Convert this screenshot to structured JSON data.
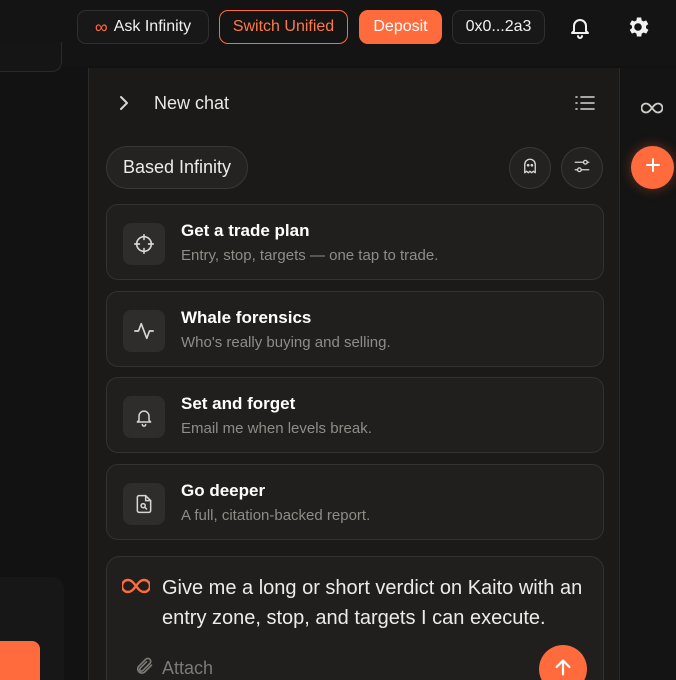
{
  "header": {
    "ask_label": "Ask Infinity",
    "ask_symbol": "∞",
    "switch_label": "Switch Unified",
    "deposit_label": "Deposit",
    "wallet_address": "0x0...2a3",
    "icons": [
      "bell-icon",
      "gear-icon"
    ]
  },
  "chat": {
    "title": "New chat",
    "model_label": "Based Infinity",
    "suggestions": [
      {
        "title": "Get a trade plan",
        "subtitle": "Entry, stop, targets — one tap to trade.",
        "icon": "crosshair-icon"
      },
      {
        "title": "Whale forensics",
        "subtitle": "Who's really buying and selling.",
        "icon": "activity-icon"
      },
      {
        "title": "Set and forget",
        "subtitle": "Email me when levels break.",
        "icon": "bell-icon"
      },
      {
        "title": "Go deeper",
        "subtitle": "A full, citation-backed report.",
        "icon": "document-search-icon"
      }
    ],
    "composer": {
      "text": "Give me a long or short verdict on Kaito with an entry zone, stop, and targets I can execute.",
      "attach_label": "Attach"
    }
  },
  "colors": {
    "accent": "#ff6b3d",
    "background": "#121212",
    "panel": "#1b1a19",
    "card": "#201f1d"
  }
}
